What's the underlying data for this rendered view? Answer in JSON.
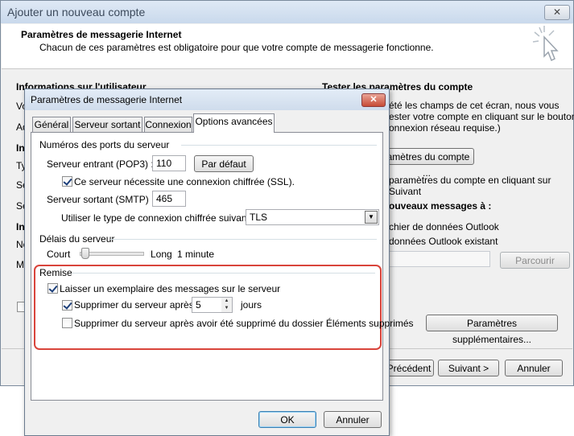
{
  "outer": {
    "title": "Ajouter un nouveau compte",
    "heading": "Paramètres de messagerie Internet",
    "subheading": "Chacun de ces paramètres est obligatoire pour que votre compte de messagerie fonctionne.",
    "user_info_heading": "Informations sur l'utilisateur",
    "left_fragments": [
      "Vo",
      "Ad",
      "In",
      "Ty",
      "Se",
      "Se",
      "In",
      "No",
      "Mo"
    ],
    "test_heading": "Tester les paramètres du compte",
    "test_desc_1": "été les champs de cet écran, nous vous",
    "test_desc_2": "ester votre compte en cliquant sur le bouton",
    "test_desc_3": "onnexion réseau requise.)",
    "test_button": "ramètres du compte ...",
    "test_auto_1": "paramètres du compte en cliquant sur",
    "test_auto_2": "Suivant",
    "new_messages_heading": "ouveaux messages à :",
    "new_file_option": "chier de données Outlook",
    "existing_file_option": "données Outlook existant",
    "browse_button": "Parcourir",
    "more_settings_button": "Paramètres supplémentaires...",
    "prev_button": "Précédent",
    "next_button": "Suivant >",
    "cancel_button": "Annuler",
    "close_symbol": "✕"
  },
  "dialog": {
    "title": "Paramètres de messagerie Internet",
    "close_symbol": "✕",
    "tabs": [
      {
        "label": "Général"
      },
      {
        "label": "Serveur sortant"
      },
      {
        "label": "Connexion"
      },
      {
        "label": "Options avancées"
      }
    ],
    "ports": {
      "group_label": "Numéros des ports du serveur",
      "incoming_label": "Serveur entrant (POP3) :",
      "incoming_value": "110",
      "default_button": "Par défaut",
      "ssl_label": "Ce serveur nécessite une connexion chiffrée (SSL).",
      "outgoing_label": "Serveur sortant (SMTP) :",
      "outgoing_value": "465",
      "encryption_label": "Utiliser le type de connexion chiffrée suivant :",
      "encryption_value": "TLS"
    },
    "timeout": {
      "group_label": "Délais du serveur",
      "short_label": "Court",
      "long_label": "Long",
      "value_text": "1 minute"
    },
    "delivery": {
      "group_label": "Remise",
      "leave_copy_label": "Laisser un exemplaire des messages sur le serveur",
      "remove_after_label": "Supprimer du serveur après",
      "remove_after_days": "5",
      "days_unit": "jours",
      "remove_deleted_label": "Supprimer du serveur après avoir été supprimé du dossier Éléments supprimés"
    },
    "ok_button": "OK",
    "cancel_button": "Annuler"
  },
  "colors": {
    "highlight": "#d9443b",
    "accent_border": "#3c7fb1"
  }
}
